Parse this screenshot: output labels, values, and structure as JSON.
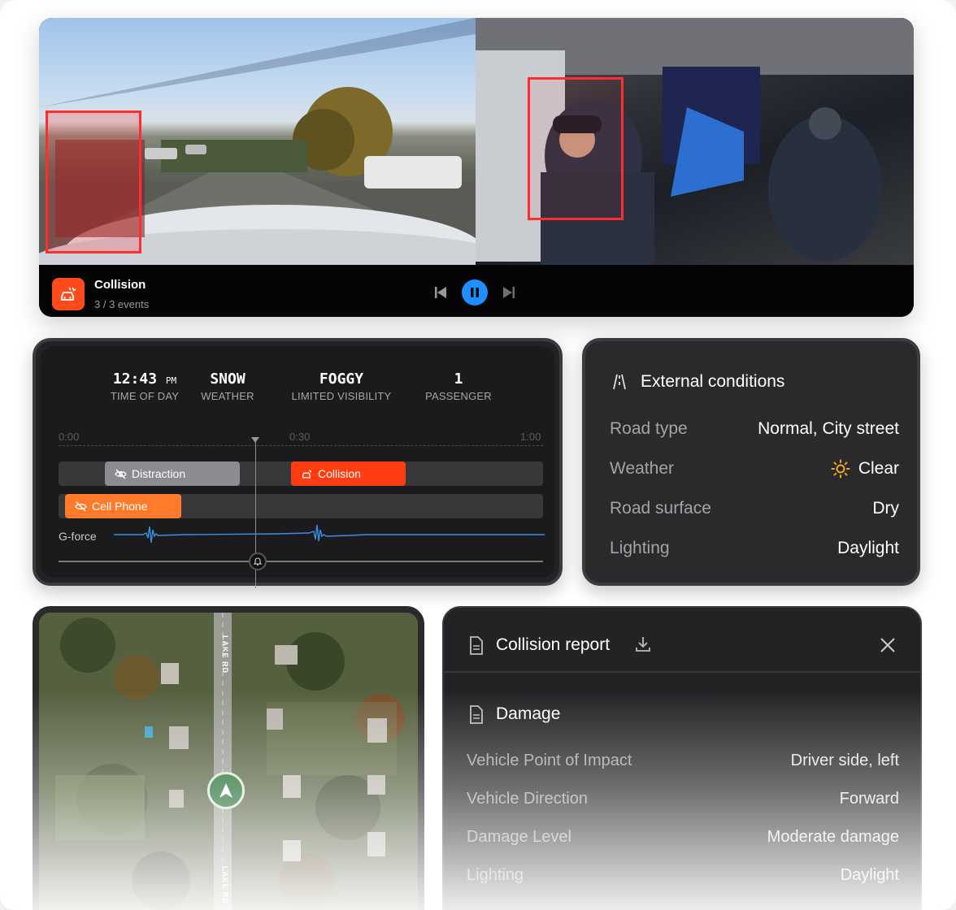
{
  "video": {
    "event_title": "Collision",
    "event_count": "3 / 3 events",
    "event_icon": "car-crash-icon",
    "accent": "#ff4a1c",
    "play_color": "#1f8fff",
    "progress_state": "playing"
  },
  "timeline": {
    "stats": [
      {
        "value": "12:43",
        "suffix": "PM",
        "label": "TIME OF DAY"
      },
      {
        "value": "SNOW",
        "suffix": "",
        "label": "WEATHER"
      },
      {
        "value": "FOGGY",
        "suffix": "",
        "label": "LIMITED VISIBILITY"
      },
      {
        "value": "1",
        "suffix": "",
        "label": "PASSENGER"
      }
    ],
    "ticks": [
      "0:00",
      "0:30",
      "1:00"
    ],
    "events": [
      {
        "label": "Distraction",
        "icon": "eye-off-icon",
        "color": "#8c8c90"
      },
      {
        "label": "Collision",
        "icon": "car-crash-icon",
        "color": "#ff3d10"
      },
      {
        "label": "Cell Phone",
        "icon": "phone-off-icon",
        "color": "#ff7a2a"
      }
    ],
    "gforce_label": "G-force"
  },
  "conditions": {
    "title": "External conditions",
    "rows": [
      {
        "key": "Road type",
        "value": "Normal, City street"
      },
      {
        "key": "Weather",
        "value": "Clear",
        "icon": "sun-icon"
      },
      {
        "key": "Road surface",
        "value": "Dry"
      },
      {
        "key": "Lighting",
        "value": "Daylight"
      }
    ]
  },
  "map": {
    "road_label_1": "LAKE RD",
    "road_label_2": "LAKE RD"
  },
  "report": {
    "title": "Collision report",
    "section": "Damage",
    "rows": [
      {
        "key": "Vehicle Point of Impact",
        "value": "Driver side, left"
      },
      {
        "key": "Vehicle Direction",
        "value": "Forward"
      },
      {
        "key": "Damage Level",
        "value": "Moderate damage"
      },
      {
        "key": "Lighting",
        "value": "Daylight"
      }
    ]
  }
}
